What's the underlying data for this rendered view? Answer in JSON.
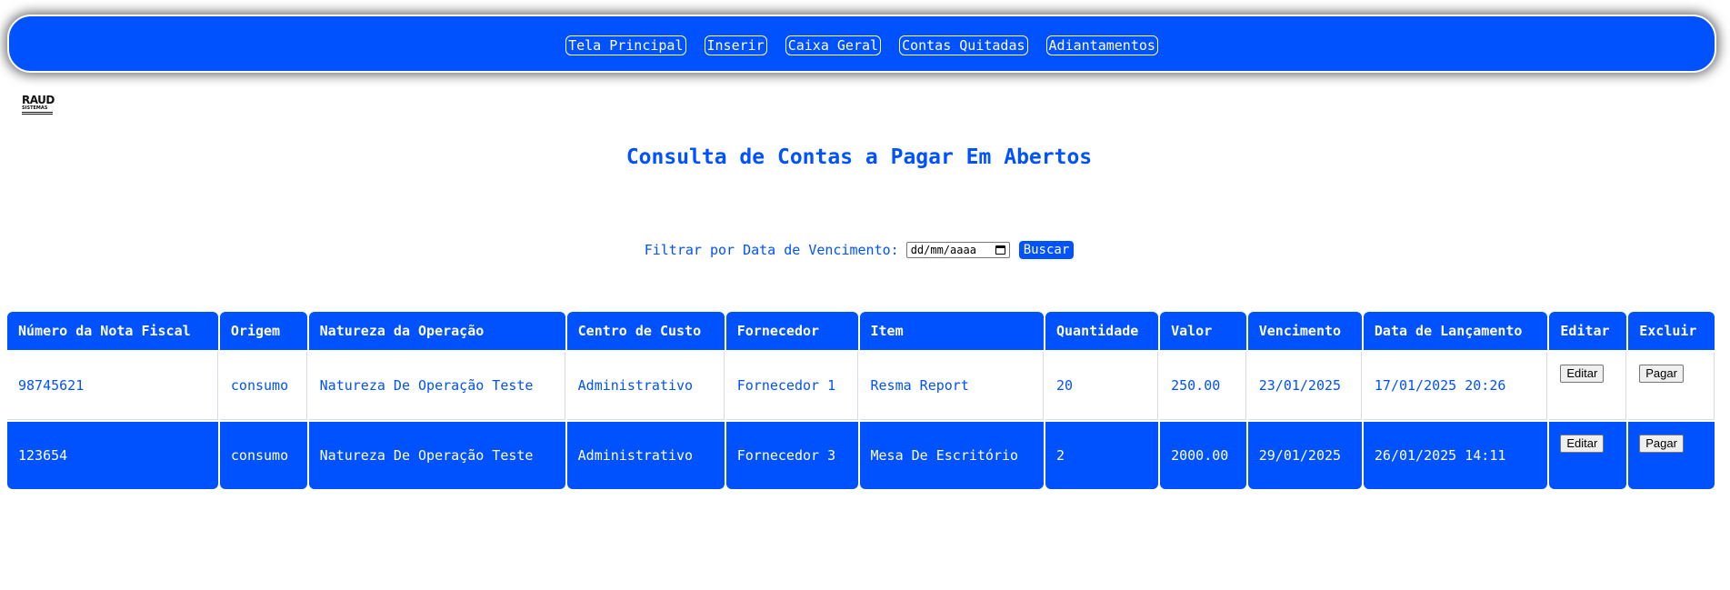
{
  "nav": {
    "items": [
      "Tela Principal",
      "Inserir",
      "Caixa Geral",
      "Contas Quitadas",
      "Adiantamentos"
    ]
  },
  "logo": {
    "line1": "RAUD",
    "line2": "SISTEMAS"
  },
  "page": {
    "title": "Consulta de Contas a Pagar Em Abertos"
  },
  "filter": {
    "label": "Filtrar por Data de Vencimento:",
    "date_placeholder": "dd/mm/aaaa",
    "search_label": "Buscar"
  },
  "table": {
    "headers": [
      "Número da Nota Fiscal",
      "Origem",
      "Natureza da Operação",
      "Centro de Custo",
      "Fornecedor",
      "Item",
      "Quantidade",
      "Valor",
      "Vencimento",
      "Data de Lançamento",
      "Editar",
      "Excluir"
    ],
    "rows": [
      {
        "nota": "98745621",
        "origem": "consumo",
        "natureza": "Natureza De Operação Teste",
        "centro": "Administrativo",
        "fornecedor": "Fornecedor 1",
        "item": "Resma Report",
        "quantidade": "20",
        "valor": "250.00",
        "vencimento": "23/01/2025",
        "lancamento": "17/01/2025 20:26",
        "edit_label": "Editar",
        "pay_label": "Pagar"
      },
      {
        "nota": "123654",
        "origem": "consumo",
        "natureza": "Natureza De Operação Teste",
        "centro": "Administrativo",
        "fornecedor": "Fornecedor 3",
        "item": "Mesa De Escritório",
        "quantidade": "2",
        "valor": "2000.00",
        "vencimento": "29/01/2025",
        "lancamento": "26/01/2025 14:11",
        "edit_label": "Editar",
        "pay_label": "Pagar"
      }
    ]
  },
  "colors": {
    "accent": "#0052ff",
    "background": "#ffffff"
  }
}
